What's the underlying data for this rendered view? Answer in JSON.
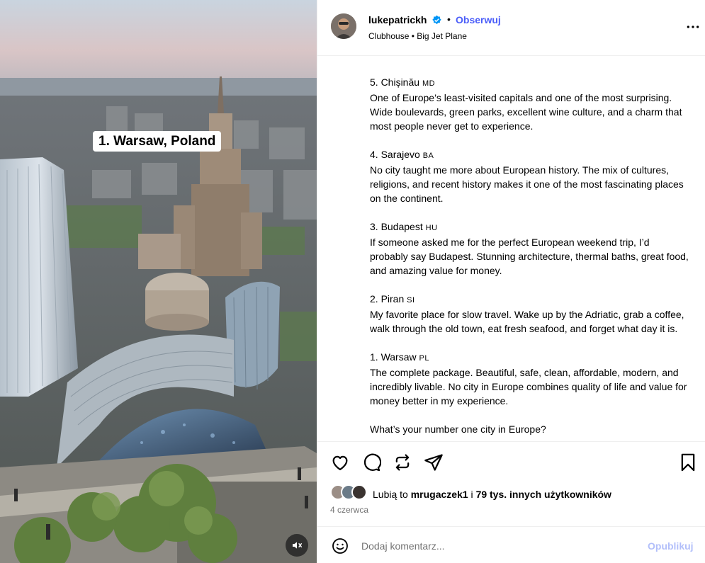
{
  "media": {
    "sticker_text": "1. Warsaw, Poland",
    "mute_icon": "speaker-muted-icon"
  },
  "header": {
    "username": "lukepatrickh",
    "separator": "•",
    "follow_label": "Obserwuj",
    "music": "Clubhouse • Big Jet Plane",
    "more_icon": "more-horizontal-icon"
  },
  "caption": {
    "entries": [
      {
        "title": "5. Chișinău",
        "code": "MD",
        "text": "One of Europe’s least-visited capitals and one of the most surprising. Wide boulevards, green parks, excellent wine culture, and a charm that most people never get to experience."
      },
      {
        "title": "4. Sarajevo",
        "code": "BA",
        "text": "No city taught me more about European history. The mix of cultures, religions, and recent history makes it one of the most fascinating places on the continent."
      },
      {
        "title": "3. Budapest",
        "code": "HU",
        "text": "If someone asked me for the perfect European weekend trip, I’d probably say Budapest. Stunning architecture, thermal baths, great food, and amazing value for money."
      },
      {
        "title": "2. Piran",
        "code": "SI",
        "text": "My favorite place for slow travel. Wake up by the Adriatic, grab a coffee, walk through the old town, eat fresh seafood, and forget what day it is."
      },
      {
        "title": "1. Warsaw",
        "code": "PL",
        "text": "The complete package. Beautiful, safe, clean, affordable, modern, and incredibly livable. No city in Europe combines quality of life and value for money better in my experience."
      }
    ],
    "closing": "What’s your number one city in Europe?"
  },
  "actions": {
    "like_icon": "heart-icon",
    "comment_icon": "comment-icon",
    "repost_icon": "repost-icon",
    "share_icon": "share-icon",
    "save_icon": "bookmark-icon"
  },
  "likes": {
    "prefix": "Lubią to",
    "user": "mrugaczek1",
    "connector": "i",
    "others": "79 tys. innych użytkowników"
  },
  "date": "4 czerwca",
  "comment": {
    "emoji_icon": "emoji-icon",
    "placeholder": "Dodaj komentarz...",
    "post_label": "Opublikuj"
  },
  "colors": {
    "accent": "#4a5df9",
    "post_disabled": "#b2bffa",
    "muted_text": "#737373",
    "verified": "#0095f6"
  }
}
